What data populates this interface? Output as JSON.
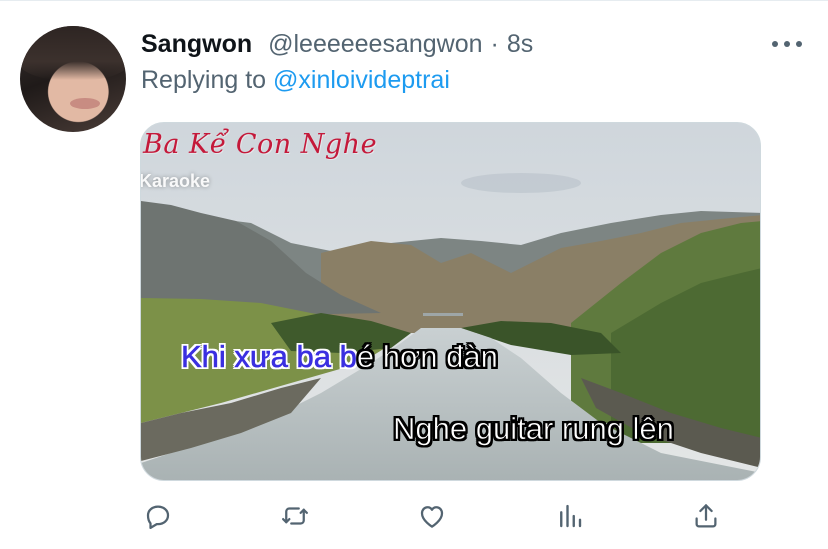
{
  "tweet": {
    "author_name": "Sangwon",
    "author_handle": "@leeeeeesangwon",
    "separator": "·",
    "time": "8s",
    "reply_prefix": "Replying to",
    "reply_to": "@xinloivideptrai"
  },
  "media": {
    "title": "Ba Kể Con Nghe",
    "subtitle": "Karaoke",
    "lyric_line1_sung": "Khi xưa ba b",
    "lyric_line1_rest": "é hơn đàn",
    "lyric_line2": "Nghe guitar rung lên"
  },
  "actions": {
    "icons": [
      "reply-icon",
      "retweet-icon",
      "like-icon",
      "views-icon",
      "share-icon"
    ]
  },
  "colors": {
    "link": "#1d9bf0",
    "secondary_text": "#536471",
    "karaoke_title": "#c4193a",
    "karaoke_highlight": "#3a2fe0"
  }
}
